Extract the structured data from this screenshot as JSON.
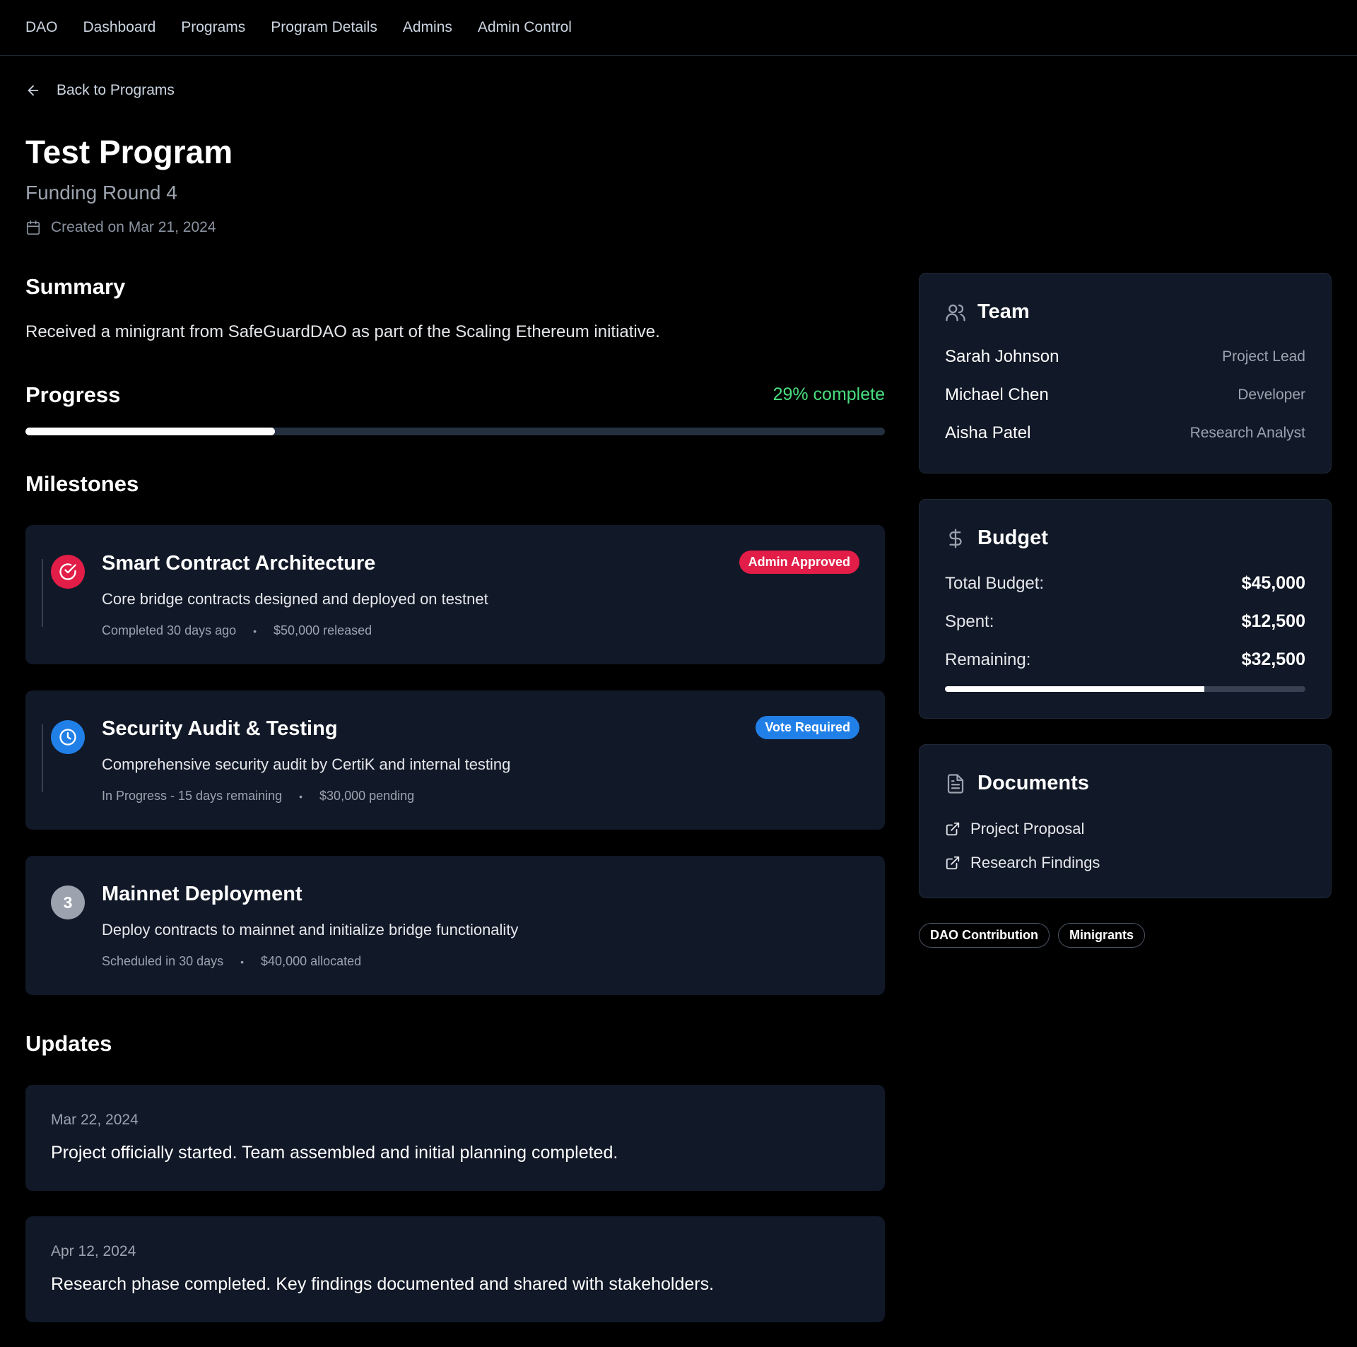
{
  "nav": {
    "items": [
      "DAO",
      "Dashboard",
      "Programs",
      "Program Details",
      "Admins",
      "Admin Control"
    ]
  },
  "back": {
    "label": "Back to Programs",
    "icon": "arrow-left-icon"
  },
  "program": {
    "title": "Test Program",
    "subtitle": "Funding Round 4",
    "created": "Created on Mar 21, 2024"
  },
  "summary": {
    "heading": "Summary",
    "text": "Received a minigrant from SafeGuardDAO as part of the Scaling Ethereum initiative."
  },
  "progress": {
    "heading": "Progress",
    "label": "29% complete",
    "value_percent": 29,
    "color": "#4ade80"
  },
  "milestones": {
    "heading": "Milestones",
    "items": [
      {
        "title": "Smart Contract Architecture",
        "description": "Core bridge contracts designed and deployed on testnet",
        "status": "Completed 30 days ago",
        "amount": "$50,000 released",
        "badge": "Admin Approved",
        "badge_color": "#e11d48",
        "icon": "check-circle-icon",
        "icon_color": "#e11d48"
      },
      {
        "title": "Security Audit & Testing",
        "description": "Comprehensive security audit by CertiK and internal testing",
        "status": "In Progress - 15 days remaining",
        "amount": "$30,000 pending",
        "badge": "Vote Required",
        "badge_color": "#2180e8",
        "icon": "clock-icon",
        "icon_color": "#2180e8"
      },
      {
        "title": "Mainnet Deployment",
        "description": "Deploy contracts to mainnet and initialize bridge functionality",
        "status": "Scheduled in 30 days",
        "amount": "$40,000 allocated",
        "number": "3",
        "icon_color": "#9ca3af"
      }
    ]
  },
  "updates": {
    "heading": "Updates",
    "items": [
      {
        "date": "Mar 22, 2024",
        "text": "Project officially started. Team assembled and initial planning completed."
      },
      {
        "date": "Apr 12, 2024",
        "text": "Research phase completed. Key findings documented and shared with stakeholders."
      }
    ]
  },
  "team": {
    "heading": "Team",
    "members": [
      {
        "name": "Sarah Johnson",
        "role": "Project Lead"
      },
      {
        "name": "Michael Chen",
        "role": "Developer"
      },
      {
        "name": "Aisha Patel",
        "role": "Research Analyst"
      }
    ]
  },
  "budget": {
    "heading": "Budget",
    "total_label": "Total Budget:",
    "total": "$45,000",
    "spent_label": "Spent:",
    "spent": "$12,500",
    "remaining_label": "Remaining:",
    "remaining": "$32,500",
    "remaining_fraction": 0.72
  },
  "documents": {
    "heading": "Documents",
    "items": [
      "Project Proposal",
      "Research Findings"
    ]
  },
  "tags": [
    "DAO Contribution",
    "Minigrants"
  ]
}
